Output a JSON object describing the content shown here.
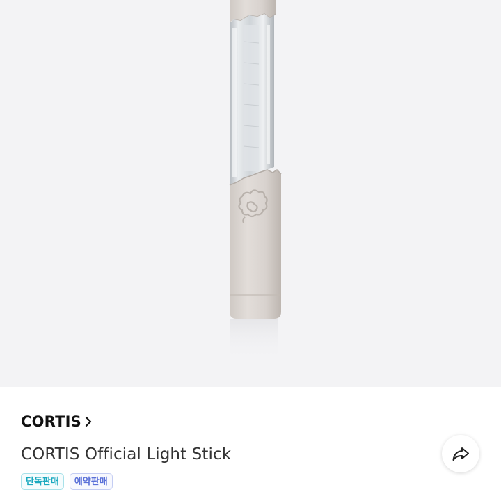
{
  "product": {
    "brand": "CORTIS",
    "title": "CORTIS Official Light Stick",
    "badges": [
      {
        "label": "단독판매",
        "color": "#1ba9bf"
      },
      {
        "label": "예약판매",
        "color": "#5a70d8"
      }
    ]
  },
  "icons": {
    "brand_chevron": "chevron-right-icon",
    "share": "share-arrow-icon",
    "emblem": "flower-emblem-icon"
  },
  "colors": {
    "hero_background": "#f3f3f5",
    "stick_body": "#d9d4d0"
  }
}
